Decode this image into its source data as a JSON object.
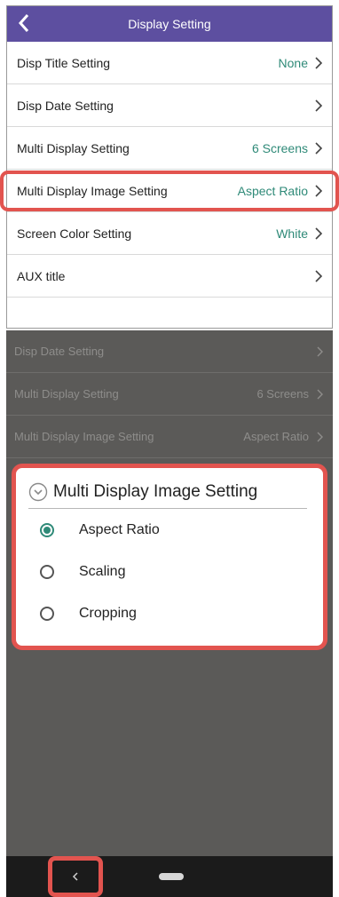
{
  "screen_top": {
    "header_title": "Display Setting",
    "rows": [
      {
        "label": "Disp Title Setting",
        "value": "None"
      },
      {
        "label": "Disp Date Setting",
        "value": ""
      },
      {
        "label": "Multi Display Setting",
        "value": "6 Screens"
      },
      {
        "label": "Multi Display Image Setting",
        "value": "Aspect Ratio"
      },
      {
        "label": "Screen Color Setting",
        "value": "White"
      },
      {
        "label": "AUX title",
        "value": ""
      }
    ]
  },
  "screen_bottom": {
    "background_rows": [
      {
        "label": "Disp Date Setting",
        "value": ""
      },
      {
        "label": "Multi Display Setting",
        "value": "6 Screens"
      },
      {
        "label": "Multi Display Image Setting",
        "value": "Aspect Ratio"
      }
    ],
    "dialog": {
      "title": "Multi Display Image Setting",
      "options": [
        {
          "label": "Aspect Ratio",
          "selected": true
        },
        {
          "label": "Scaling",
          "selected": false
        },
        {
          "label": "Cropping",
          "selected": false
        }
      ]
    }
  },
  "icons": {
    "header_back": "chevron-left-icon",
    "row_arrow": "chevron-right-icon",
    "dialog_header": "chevron-down-circle-icon",
    "nav_back": "nav-back-icon",
    "nav_home": "nav-home-pill-icon"
  },
  "colors": {
    "header_bg": "#5d4fa0",
    "accent_value": "#2f8a78",
    "highlight": "#e2544f",
    "overlay_bg": "#5b5a58",
    "navbar_bg": "#1b1b1b"
  }
}
